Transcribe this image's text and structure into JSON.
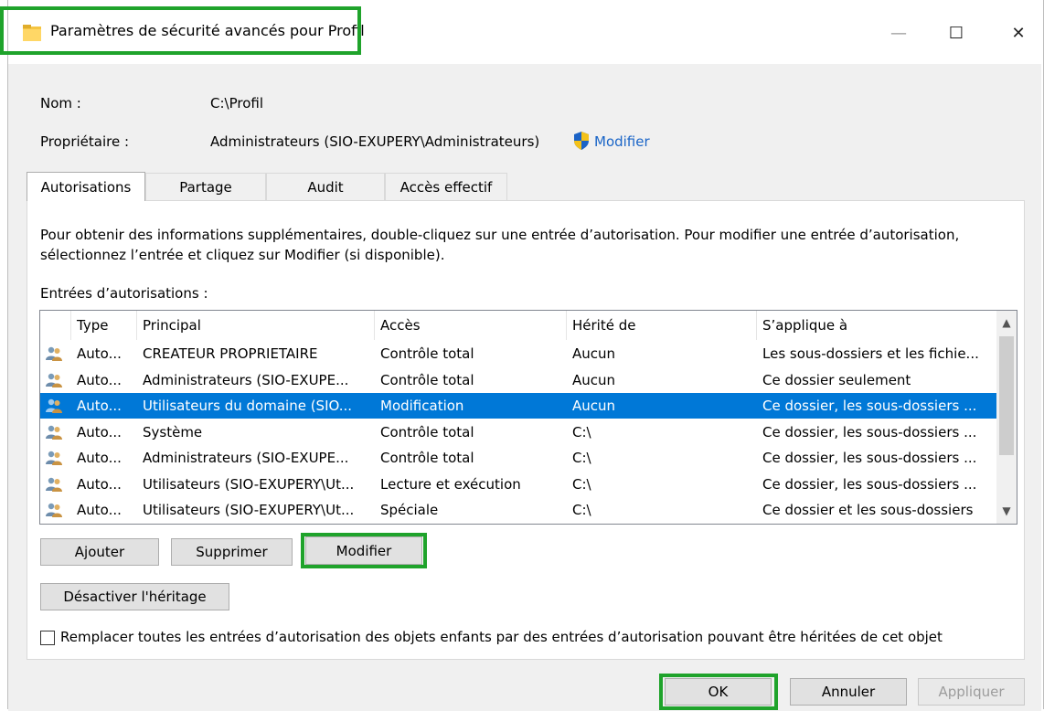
{
  "window": {
    "title": "Paramètres de sécurité avancés pour Profil",
    "controls": {
      "minimize": "—",
      "maximize": "☐",
      "close": "✕"
    }
  },
  "info": {
    "name_label": "Nom :",
    "name_value": "C:\\Profil",
    "owner_label": "Propriétaire :",
    "owner_value": "Administrateurs (SIO-EXUPERY\\Administrateurs)",
    "owner_change_link": "Modifier"
  },
  "tabs": [
    {
      "label": "Autorisations",
      "active": true
    },
    {
      "label": "Partage",
      "active": false
    },
    {
      "label": "Audit",
      "active": false
    },
    {
      "label": "Accès effectif",
      "active": false
    }
  ],
  "panel": {
    "description_line1": "Pour obtenir des informations supplémentaires, double-cliquez sur une entrée d’autorisation. Pour modifier une entrée d’autorisation,",
    "description_line2": "sélectionnez l’entrée et cliquez sur Modifier (si disponible).",
    "entries_label": "Entrées d’autorisations :"
  },
  "table": {
    "headers": [
      "Type",
      "Principal",
      "Accès",
      "Hérité de",
      "S’applique à"
    ],
    "rows": [
      {
        "type": "Auto...",
        "principal": "CREATEUR PROPRIETAIRE",
        "access": "Contrôle total",
        "inherited": "Aucun",
        "applies": "Les sous-dossiers et les fichie..."
      },
      {
        "type": "Auto...",
        "principal": "Administrateurs (SIO-EXUPE...",
        "access": "Contrôle total",
        "inherited": "Aucun",
        "applies": "Ce dossier seulement"
      },
      {
        "type": "Auto...",
        "principal": "Utilisateurs du domaine (SIO...",
        "access": "Modification",
        "inherited": "Aucun",
        "applies": "Ce dossier, les sous-dossiers ...",
        "selected": true
      },
      {
        "type": "Auto...",
        "principal": "Système",
        "access": "Contrôle total",
        "inherited": "C:\\",
        "applies": "Ce dossier, les sous-dossiers ..."
      },
      {
        "type": "Auto...",
        "principal": "Administrateurs (SIO-EXUPE...",
        "access": "Contrôle total",
        "inherited": "C:\\",
        "applies": "Ce dossier, les sous-dossiers ..."
      },
      {
        "type": "Auto...",
        "principal": "Utilisateurs (SIO-EXUPERY\\Ut...",
        "access": "Lecture et exécution",
        "inherited": "C:\\",
        "applies": "Ce dossier, les sous-dossiers ..."
      },
      {
        "type": "Auto...",
        "principal": "Utilisateurs (SIO-EXUPERY\\Ut...",
        "access": "Spéciale",
        "inherited": "C:\\",
        "applies": "Ce dossier et les sous-dossiers"
      }
    ]
  },
  "buttons": {
    "add": "Ajouter",
    "remove": "Supprimer",
    "edit": "Modifier",
    "disable_inheritance": "Désactiver l'héritage",
    "ok": "OK",
    "cancel": "Annuler",
    "apply": "Appliquer"
  },
  "replace_checkbox": {
    "label": "Remplacer toutes les entrées d’autorisation des objets enfants par des entrées d’autorisation pouvant être héritées de cet objet",
    "checked": false
  },
  "colors": {
    "highlight": "#1fa32b",
    "selection": "#0078d7",
    "link": "#1a65c7"
  }
}
